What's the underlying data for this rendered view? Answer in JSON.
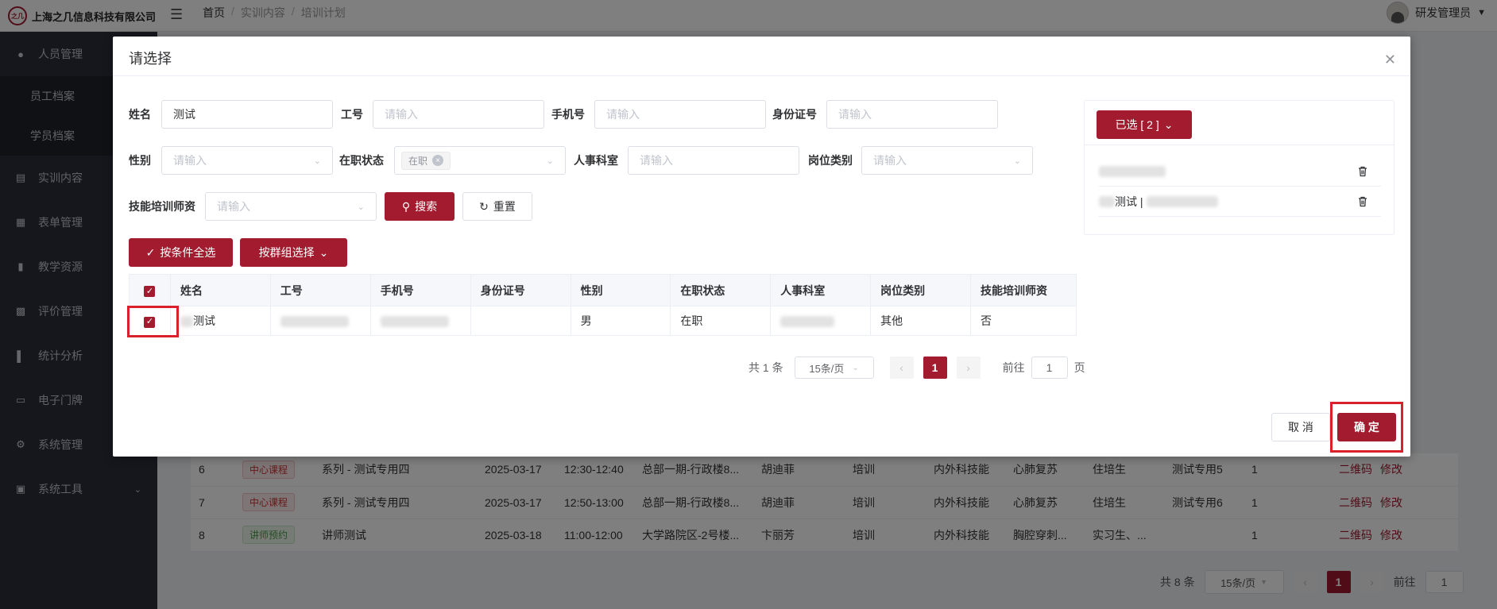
{
  "app": {
    "logo_mark": "之几",
    "company": "上海之几信息科技有限公司",
    "breadcrumb": [
      "首页",
      "实训内容",
      "培训计划"
    ],
    "breadcrumb_sep": "/",
    "user": "研发管理员"
  },
  "sidebar": {
    "items": [
      {
        "label": "人员管理",
        "icon": "user-icon"
      },
      {
        "label": "员工档案"
      },
      {
        "label": "学员档案"
      },
      {
        "label": "实训内容",
        "icon": "book-icon"
      },
      {
        "label": "表单管理",
        "icon": "form-icon"
      },
      {
        "label": "教学资源",
        "icon": "resource-icon"
      },
      {
        "label": "评价管理",
        "icon": "rating-icon"
      },
      {
        "label": "统计分析",
        "icon": "chart-icon"
      },
      {
        "label": "电子门牌",
        "icon": "monitor-icon"
      },
      {
        "label": "系统管理",
        "icon": "gear-icon"
      },
      {
        "label": "系统工具",
        "icon": "toolbox-icon"
      }
    ]
  },
  "background_table": {
    "rows": [
      {
        "no": "6",
        "tag": "中心课程",
        "tag_type": "red",
        "name": "系列 - 测试专用四",
        "date": "2025-03-17",
        "time": "12:30-12:40",
        "place": "总部一期-行政楼8...",
        "teacher": "胡迪菲",
        "type": "培训",
        "dept": "内外科技能",
        "skill": "心肺复苏",
        "target": "住培生",
        "extra": "测试专用5",
        "count": "1",
        "action1": "二维码",
        "action2": "修改"
      },
      {
        "no": "7",
        "tag": "中心课程",
        "tag_type": "red",
        "name": "系列 - 测试专用四",
        "date": "2025-03-17",
        "time": "12:50-13:00",
        "place": "总部一期-行政楼8...",
        "teacher": "胡迪菲",
        "type": "培训",
        "dept": "内外科技能",
        "skill": "心肺复苏",
        "target": "住培生",
        "extra": "测试专用6",
        "count": "1",
        "action1": "二维码",
        "action2": "修改"
      },
      {
        "no": "8",
        "tag": "讲师预约",
        "tag_type": "green",
        "name": "讲师测试",
        "date": "2025-03-18",
        "time": "11:00-12:00",
        "place": "大学路院区-2号楼...",
        "teacher": "卞丽芳",
        "type": "培训",
        "dept": "内外科技能",
        "skill": "胸腔穿刺...",
        "target": "实习生、...",
        "extra": "",
        "count": "1",
        "action1": "二维码",
        "action2": "修改"
      }
    ],
    "pager": {
      "total": "共 8 条",
      "page_size": "15条/页",
      "current": "1",
      "goto_label": "前往",
      "goto_value": "1"
    }
  },
  "dialog": {
    "title": "请选择",
    "filters": {
      "name_label": "姓名",
      "name_value": "测试",
      "jobno_label": "工号",
      "jobno_placeholder": "请输入",
      "phone_label": "手机号",
      "phone_placeholder": "请输入",
      "idcard_label": "身份证号",
      "idcard_placeholder": "请输入",
      "gender_label": "性别",
      "gender_placeholder": "请输入",
      "status_label": "在职状态",
      "status_chip": "在职",
      "hrdept_label": "人事科室",
      "hrdept_placeholder": "请输入",
      "post_label": "岗位类别",
      "post_placeholder": "请输入",
      "trainer_label": "技能培训师资",
      "trainer_placeholder": "请输入"
    },
    "search_button": "搜索",
    "reset_button": "重置",
    "select_all_button": "按条件全选",
    "group_select_button": "按群组选择",
    "table": {
      "columns": [
        "姓名",
        "工号",
        "手机号",
        "身份证号",
        "性别",
        "在职状态",
        "人事科室",
        "岗位类别",
        "技能培训师资"
      ],
      "rows": [
        {
          "name": "测试",
          "gender": "男",
          "status": "在职",
          "post": "其他",
          "trainer": "否"
        }
      ]
    },
    "pager": {
      "total": "共 1 条",
      "page_size": "15条/页",
      "current": "1",
      "goto_label": "前往",
      "goto_value": "1",
      "page_suffix": "页"
    },
    "selected": {
      "button_label": "已选 [ 2 ]",
      "items": [
        {
          "text": ""
        },
        {
          "text": "测试 |"
        }
      ]
    },
    "cancel_button": "取 消",
    "confirm_button": "确 定"
  },
  "colors": {
    "primary": "#a31b2e",
    "highlight": "#d9202b"
  }
}
